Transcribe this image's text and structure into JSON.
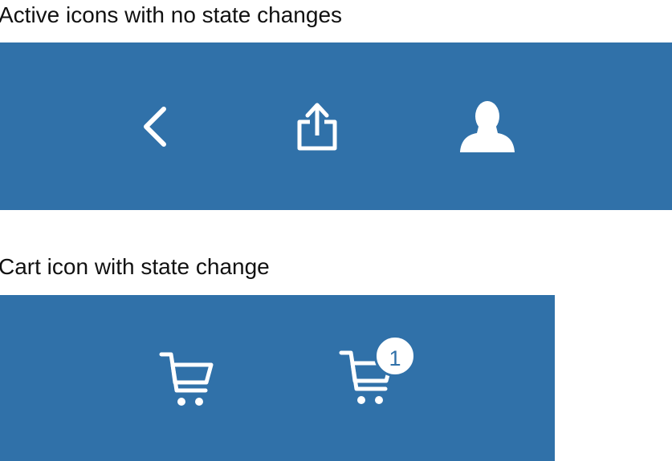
{
  "sections": [
    {
      "title": "Active icons with no state changes",
      "icons": [
        "chevron-left-icon",
        "share-icon",
        "user-icon"
      ]
    },
    {
      "title": "Cart icon with state change",
      "icons": [
        "shopping-cart-icon",
        "shopping-cart-icon"
      ],
      "badge_count": "1"
    }
  ],
  "colors": {
    "panel_background": "#3071a9",
    "icon": "#ffffff",
    "text": "#111111"
  }
}
